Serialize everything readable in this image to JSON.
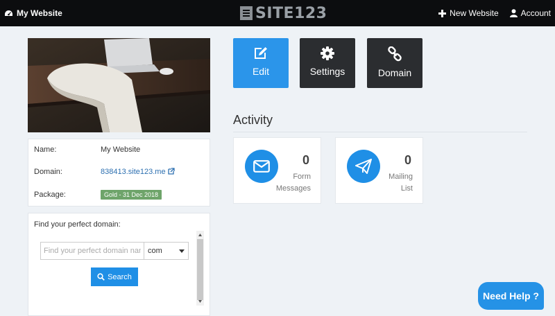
{
  "topbar": {
    "site_name": "My Website",
    "logo_text": "SITE123",
    "new_website": "New Website",
    "account": "Account"
  },
  "info": {
    "name_label": "Name:",
    "name_value": "My Website",
    "domain_label": "Domain:",
    "domain_value": "838413.site123.me",
    "package_label": "Package:",
    "package_value": "Gold - 31 Dec 2018"
  },
  "domain_search": {
    "title": "Find your perfect domain:",
    "placeholder": "Find your perfect domain name",
    "tld_selected": "com",
    "search_label": "Search"
  },
  "tiles": {
    "edit": "Edit",
    "settings": "Settings",
    "domain": "Domain"
  },
  "activity": {
    "title": "Activity",
    "form_count": "0",
    "form_label_1": "Form",
    "form_label_2": "Messages",
    "mailing_count": "0",
    "mailing_label_1": "Mailing",
    "mailing_label_2": "List"
  },
  "help": {
    "label": "Need Help ?"
  },
  "colors": {
    "accent": "#1f8fe6",
    "topbar": "#0c0d0f",
    "dark_tile": "#2b2d30",
    "package_badge": "#6ea46a",
    "background": "#eef2f6"
  },
  "icons": [
    "dashboard-icon",
    "plus-icon",
    "user-icon",
    "external-link-icon",
    "search-icon",
    "chevron-down-icon",
    "pencil-edit-icon",
    "gear-icon",
    "link-chain-icon",
    "envelope-icon",
    "paper-plane-icon"
  ]
}
